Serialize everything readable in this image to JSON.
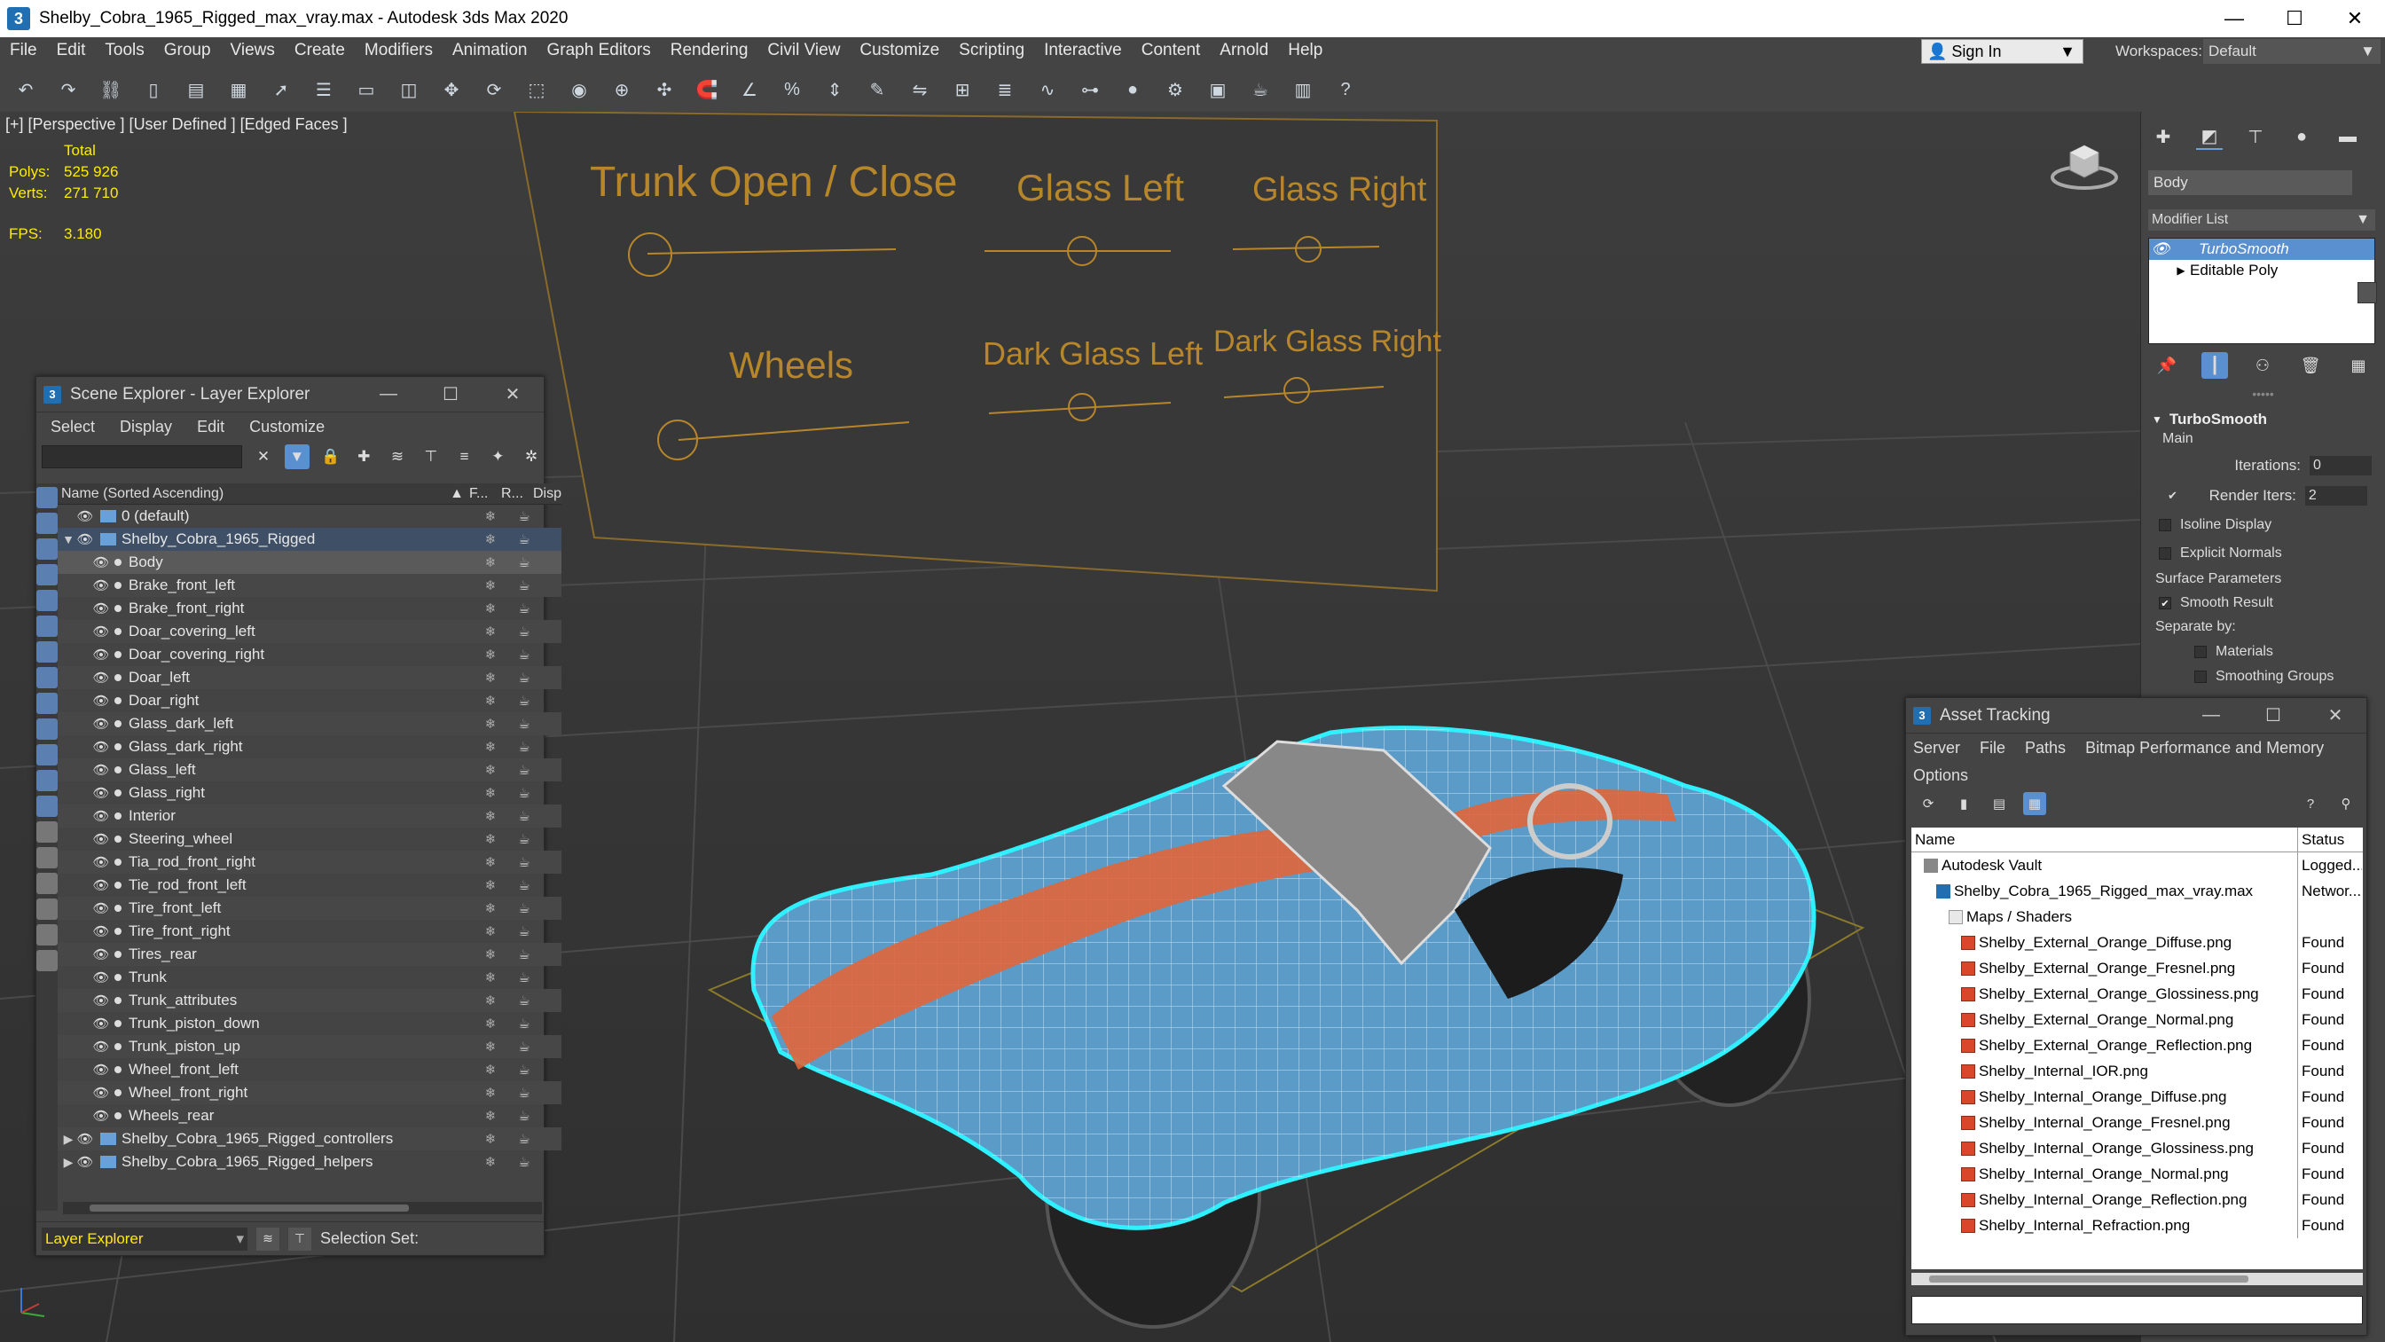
{
  "window": {
    "title": "Shelby_Cobra_1965_Rigged_max_vray.max - Autodesk 3ds Max 2020",
    "app_icon": "3",
    "min": "—",
    "max": "☐",
    "close": "✕"
  },
  "menus": [
    "File",
    "Edit",
    "Tools",
    "Group",
    "Views",
    "Create",
    "Modifiers",
    "Animation",
    "Graph Editors",
    "Rendering",
    "Civil View",
    "Customize",
    "Scripting",
    "Interactive",
    "Content",
    "Arnold",
    "Help"
  ],
  "signin": {
    "label": "Sign In",
    "caret": "▼"
  },
  "workspace": {
    "label": "Workspaces:",
    "value": "Default",
    "caret": "▼"
  },
  "viewport": {
    "label": "[+] [Perspective ] [User Defined ] [Edged Faces ]",
    "stats": {
      "header": "Total",
      "polys_label": "Polys:",
      "polys": "525 926",
      "verts_label": "Verts:",
      "verts": "271 710",
      "fps_label": "FPS:",
      "fps": "3.180"
    },
    "controls": {
      "trunk": "Trunk Open / Close",
      "glass_left": "Glass Left",
      "glass_right": "Glass Right",
      "wheels": "Wheels",
      "dark_glass_left": "Dark Glass Left",
      "dark_glass_right": "Dark Glass Right"
    },
    "colors": {
      "body": "#5b9bc8",
      "stripe": "#e0663a",
      "wire": "#d8f0ff",
      "outline": "#2ef0ff",
      "control_text": "#b8862a"
    }
  },
  "scene_explorer": {
    "title": "Scene Explorer - Layer Explorer",
    "menus": [
      "Select",
      "Display",
      "Edit",
      "Customize"
    ],
    "columns": {
      "name": "Name (Sorted Ascending)",
      "sort": "▲",
      "f": "F...",
      "r": "R...",
      "d": "Disp"
    },
    "rows": [
      {
        "name": "0 (default)",
        "level": 0,
        "type": "layer",
        "toggle": ""
      },
      {
        "name": "Shelby_Cobra_1965_Rigged",
        "level": 0,
        "type": "layer-top",
        "toggle": "▼"
      },
      {
        "name": "Body",
        "level": 1,
        "type": "obj",
        "toggle": ""
      },
      {
        "name": "Brake_front_left",
        "level": 1,
        "type": "obj",
        "toggle": ""
      },
      {
        "name": "Brake_front_right",
        "level": 1,
        "type": "obj",
        "toggle": ""
      },
      {
        "name": "Doar_covering_left",
        "level": 1,
        "type": "obj",
        "toggle": ""
      },
      {
        "name": "Doar_covering_right",
        "level": 1,
        "type": "obj",
        "toggle": ""
      },
      {
        "name": "Doar_left",
        "level": 1,
        "type": "obj",
        "toggle": ""
      },
      {
        "name": "Doar_right",
        "level": 1,
        "type": "obj",
        "toggle": ""
      },
      {
        "name": "Glass_dark_left",
        "level": 1,
        "type": "obj",
        "toggle": ""
      },
      {
        "name": "Glass_dark_right",
        "level": 1,
        "type": "obj",
        "toggle": ""
      },
      {
        "name": "Glass_left",
        "level": 1,
        "type": "obj",
        "toggle": ""
      },
      {
        "name": "Glass_right",
        "level": 1,
        "type": "obj",
        "toggle": ""
      },
      {
        "name": "Interior",
        "level": 1,
        "type": "obj",
        "toggle": ""
      },
      {
        "name": "Steering_wheel",
        "level": 1,
        "type": "obj",
        "toggle": ""
      },
      {
        "name": "Tia_rod_front_right",
        "level": 1,
        "type": "obj",
        "toggle": ""
      },
      {
        "name": "Tie_rod_front_left",
        "level": 1,
        "type": "obj",
        "toggle": ""
      },
      {
        "name": "Tire_front_left",
        "level": 1,
        "type": "obj",
        "toggle": ""
      },
      {
        "name": "Tire_front_right",
        "level": 1,
        "type": "obj",
        "toggle": ""
      },
      {
        "name": "Tires_rear",
        "level": 1,
        "type": "obj",
        "toggle": ""
      },
      {
        "name": "Trunk",
        "level": 1,
        "type": "obj",
        "toggle": ""
      },
      {
        "name": "Trunk_attributes",
        "level": 1,
        "type": "obj",
        "toggle": ""
      },
      {
        "name": "Trunk_piston_down",
        "level": 1,
        "type": "obj",
        "toggle": ""
      },
      {
        "name": "Trunk_piston_up",
        "level": 1,
        "type": "obj",
        "toggle": ""
      },
      {
        "name": "Wheel_front_left",
        "level": 1,
        "type": "obj",
        "toggle": ""
      },
      {
        "name": "Wheel_front_right",
        "level": 1,
        "type": "obj",
        "toggle": ""
      },
      {
        "name": "Wheels_rear",
        "level": 1,
        "type": "obj",
        "toggle": ""
      },
      {
        "name": "Shelby_Cobra_1965_Rigged_controllers",
        "level": 0,
        "type": "layer",
        "toggle": "▶"
      },
      {
        "name": "Shelby_Cobra_1965_Rigged_helpers",
        "level": 0,
        "type": "layer",
        "toggle": "▶"
      }
    ],
    "selected_row": "Body",
    "footer": {
      "layer": "Layer Explorer",
      "caret": "▾",
      "selection_set": "Selection Set:"
    }
  },
  "command_panel": {
    "object_name": "Body",
    "modifier_list": "Modifier List",
    "caret": "▼",
    "stack": [
      {
        "name": "TurboSmooth",
        "selected": true,
        "icon": "👁",
        "arrow": ""
      },
      {
        "name": "Editable Poly",
        "selected": false,
        "icon": "",
        "arrow": "▶"
      }
    ],
    "rollout": {
      "title": "TurboSmooth",
      "main": "Main",
      "iterations_label": "Iterations:",
      "iterations": "0",
      "render_iters_label": "Render Iters:",
      "render_iters": "2",
      "isoline": "Isoline Display",
      "explicit": "Explicit Normals",
      "surface": "Surface Parameters",
      "smooth_result": "Smooth Result",
      "separate_by": "Separate by:",
      "materials": "Materials",
      "smoothing_groups": "Smoothing Groups"
    }
  },
  "asset_tracking": {
    "title": "Asset Tracking",
    "menus": [
      "Server",
      "File",
      "Paths",
      "Bitmap Performance and Memory",
      "Options"
    ],
    "columns": {
      "name": "Name",
      "status": "Status"
    },
    "rows": [
      {
        "name": "Autodesk Vault",
        "status": "Logged...",
        "indent": 0,
        "icon": "vault"
      },
      {
        "name": "Shelby_Cobra_1965_Rigged_max_vray.max",
        "status": "Networ...",
        "indent": 1,
        "icon": "max"
      },
      {
        "name": "Maps / Shaders",
        "status": "",
        "indent": 2,
        "icon": "fold"
      },
      {
        "name": "Shelby_External_Orange_Diffuse.png",
        "status": "Found",
        "indent": 3,
        "icon": "png"
      },
      {
        "name": "Shelby_External_Orange_Fresnel.png",
        "status": "Found",
        "indent": 3,
        "icon": "png"
      },
      {
        "name": "Shelby_External_Orange_Glossiness.png",
        "status": "Found",
        "indent": 3,
        "icon": "png"
      },
      {
        "name": "Shelby_External_Orange_Normal.png",
        "status": "Found",
        "indent": 3,
        "icon": "png"
      },
      {
        "name": "Shelby_External_Orange_Reflection.png",
        "status": "Found",
        "indent": 3,
        "icon": "png"
      },
      {
        "name": "Shelby_Internal_IOR.png",
        "status": "Found",
        "indent": 3,
        "icon": "png"
      },
      {
        "name": "Shelby_Internal_Orange_Diffuse.png",
        "status": "Found",
        "indent": 3,
        "icon": "png"
      },
      {
        "name": "Shelby_Internal_Orange_Fresnel.png",
        "status": "Found",
        "indent": 3,
        "icon": "png"
      },
      {
        "name": "Shelby_Internal_Orange_Glossiness.png",
        "status": "Found",
        "indent": 3,
        "icon": "png"
      },
      {
        "name": "Shelby_Internal_Orange_Normal.png",
        "status": "Found",
        "indent": 3,
        "icon": "png"
      },
      {
        "name": "Shelby_Internal_Orange_Reflection.png",
        "status": "Found",
        "indent": 3,
        "icon": "png"
      },
      {
        "name": "Shelby_Internal_Refraction.png",
        "status": "Found",
        "indent": 3,
        "icon": "png"
      }
    ]
  }
}
